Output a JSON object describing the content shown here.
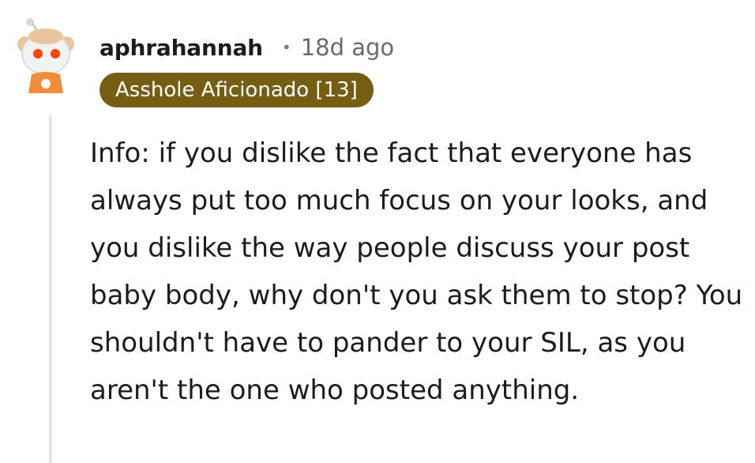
{
  "comment": {
    "author": "aphrahannah",
    "separator": "•",
    "timestamp": "18d ago",
    "flair": "Asshole Aficionado [13]",
    "flair_color": "#755d11",
    "avatar_icon": "snoo-avatar-icon",
    "body": "Info: if you dislike the fact that everyone has always put too much focus on your looks, and you dislike the way people discuss your post baby body, why don't you ask them to stop? You shouldn't have to pander to your SIL, as you aren't the one who posted anything."
  }
}
